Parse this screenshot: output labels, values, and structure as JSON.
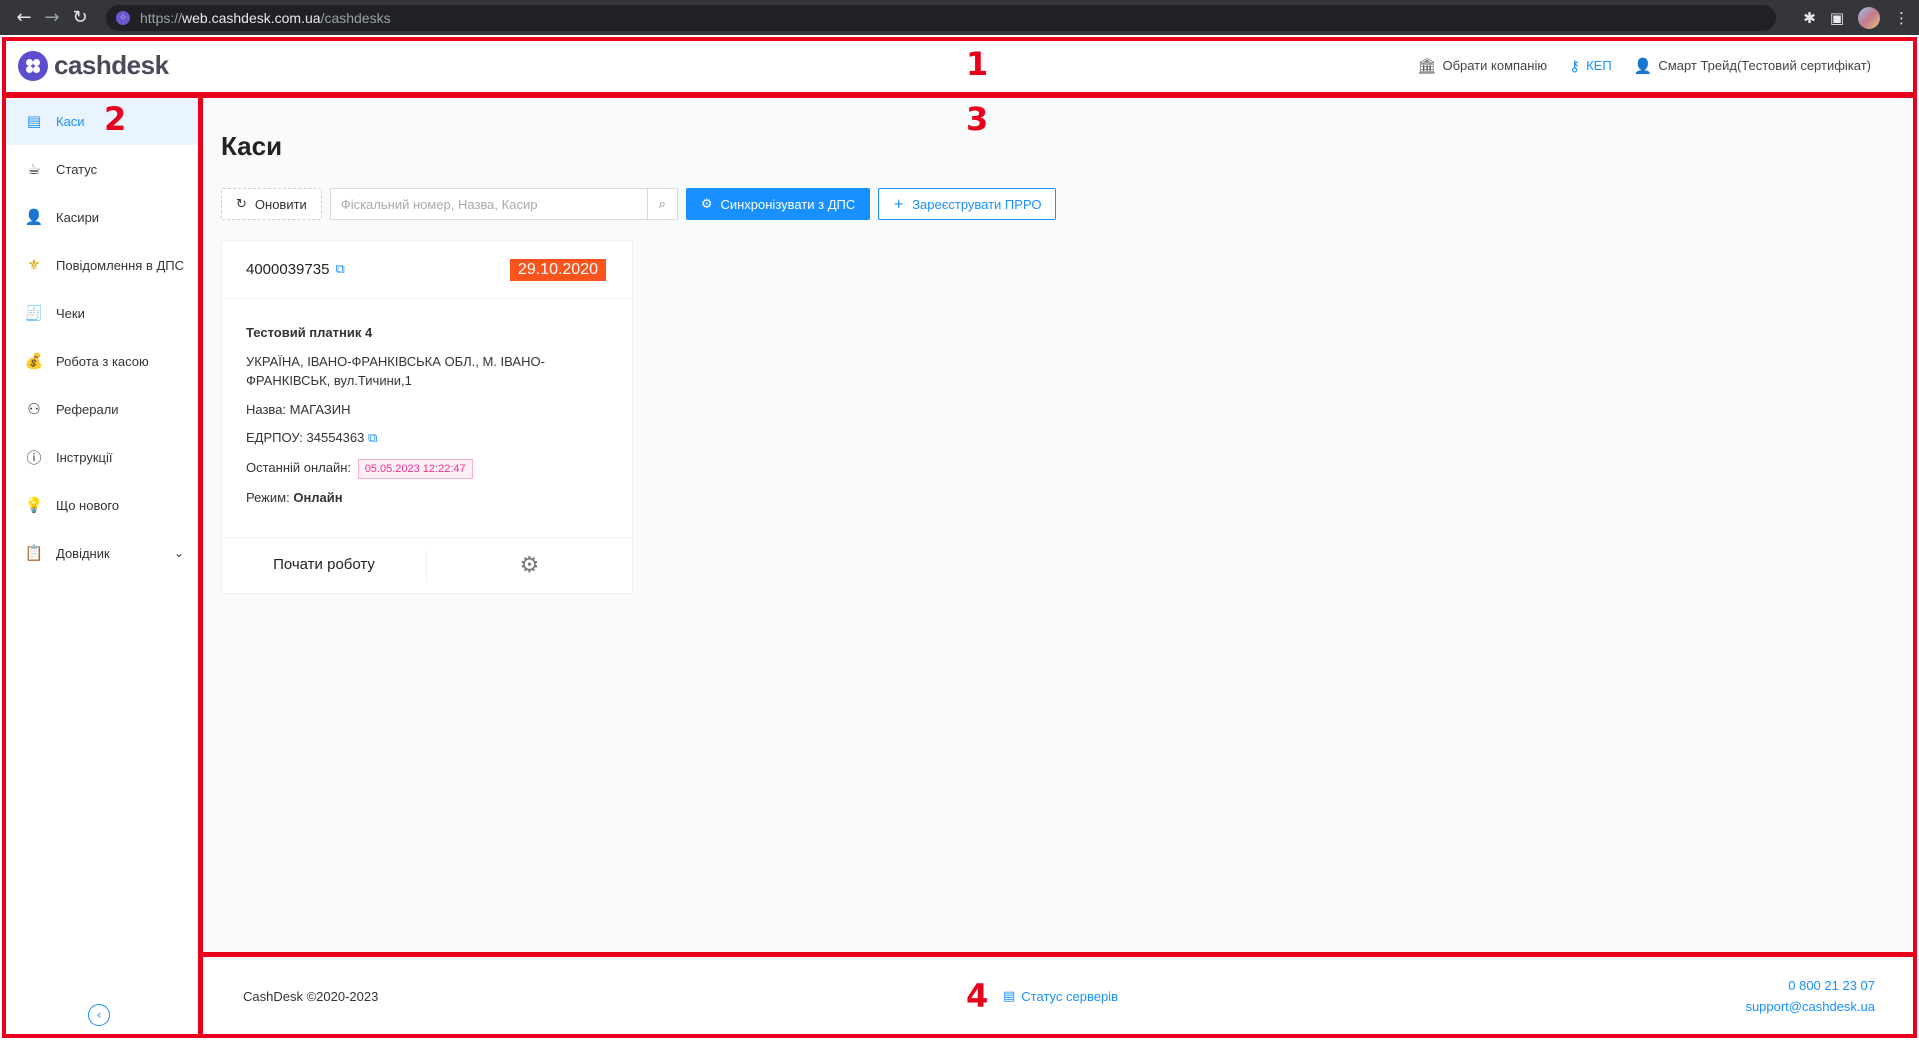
{
  "browser": {
    "url_scheme": "https://",
    "url_host": "web.cashdesk.com.ua",
    "url_path": "/cashdesks"
  },
  "header": {
    "logo_text": "cashdesk",
    "choose_company": "Обрати компанію",
    "kep": "КЕП",
    "user": "Смарт Трейд(Тестовий сертифікат)"
  },
  "sidebar": {
    "items": [
      {
        "label": "Каси",
        "icon": "cash-register-icon",
        "active": true
      },
      {
        "label": "Статус",
        "icon": "cup-icon"
      },
      {
        "label": "Касири",
        "icon": "user-icon"
      },
      {
        "label": "Повідомлення в ДПС",
        "icon": "trident-icon"
      },
      {
        "label": "Чеки",
        "icon": "receipts-icon"
      },
      {
        "label": "Робота з касою",
        "icon": "money-bag-icon"
      },
      {
        "label": "Реферали",
        "icon": "referral-icon"
      },
      {
        "label": "Інструкції",
        "icon": "info-icon"
      },
      {
        "label": "Що нового",
        "icon": "bulb-icon"
      },
      {
        "label": "Довідник",
        "icon": "handbook-icon"
      }
    ]
  },
  "main": {
    "title": "Каси",
    "refresh_label": "Оновити",
    "search_placeholder": "Фіскальний номер, Назва, Касир",
    "sync_label": "Синхронізувати з ДПС",
    "register_label": "Зареєструвати ПРРО",
    "card": {
      "fiscal_number": "4000039735",
      "date": "29.10.2020",
      "payer": "Тестовий платник 4",
      "address": "УКРАЇНА, ІВАНО-ФРАНКІВСЬКА ОБЛ., М. ІВАНО-ФРАНКІВСЬК, вул.Тичини,1",
      "name_label": "Назва:",
      "name_value": "МАГАЗИН",
      "edrpou_label": "ЕДРПОУ:",
      "edrpou_value": "34554363",
      "last_online_label": "Останній онлайн:",
      "last_online_value": "05.05.2023 12:22:47",
      "mode_label": "Режим:",
      "mode_value": "Онлайн",
      "start_label": "Почати роботу"
    }
  },
  "footer": {
    "copyright": "CashDesk ©2020-2023",
    "server_status": "Статус серверів",
    "phone": "0 800 21 23 07",
    "email": "support@cashdesk.ua"
  },
  "annotations": [
    "1",
    "2",
    "3",
    "4"
  ],
  "colors": {
    "accent": "#1890ff",
    "date_badge": "#fa541c",
    "annotation": "#e8001c",
    "logo": "#5b4fcf"
  }
}
